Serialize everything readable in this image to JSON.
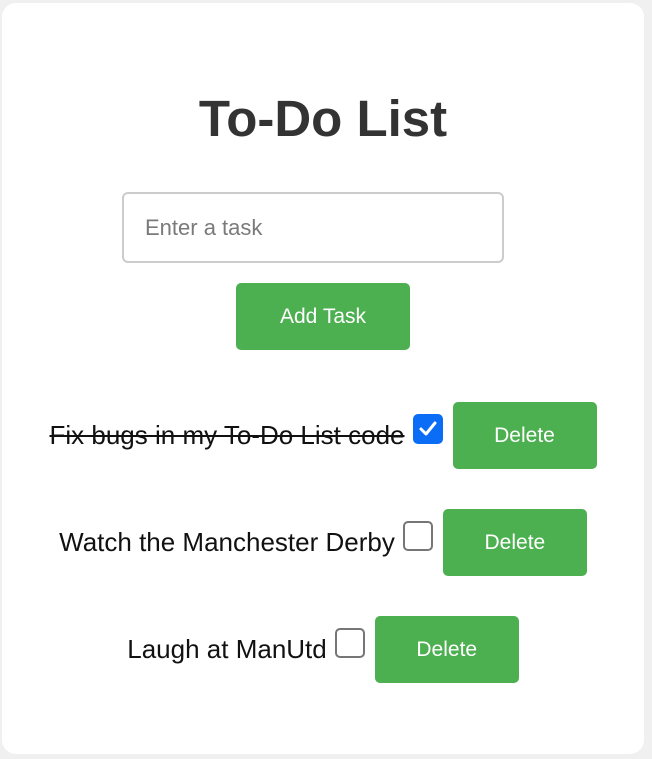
{
  "app": {
    "title": "To-Do List"
  },
  "input": {
    "placeholder": "Enter a task",
    "value": ""
  },
  "add_button": {
    "label": "Add Task"
  },
  "tasks": [
    {
      "text": "Fix bugs in my To-Do List code",
      "completed": true,
      "delete_label": "Delete"
    },
    {
      "text": "Watch the Manchester Derby",
      "completed": false,
      "delete_label": "Delete"
    },
    {
      "text": "Laugh at ManUtd",
      "completed": false,
      "delete_label": "Delete"
    }
  ],
  "colors": {
    "accent": "#4caf50",
    "checkbox_checked": "#0b6cf6",
    "title": "#333333"
  }
}
